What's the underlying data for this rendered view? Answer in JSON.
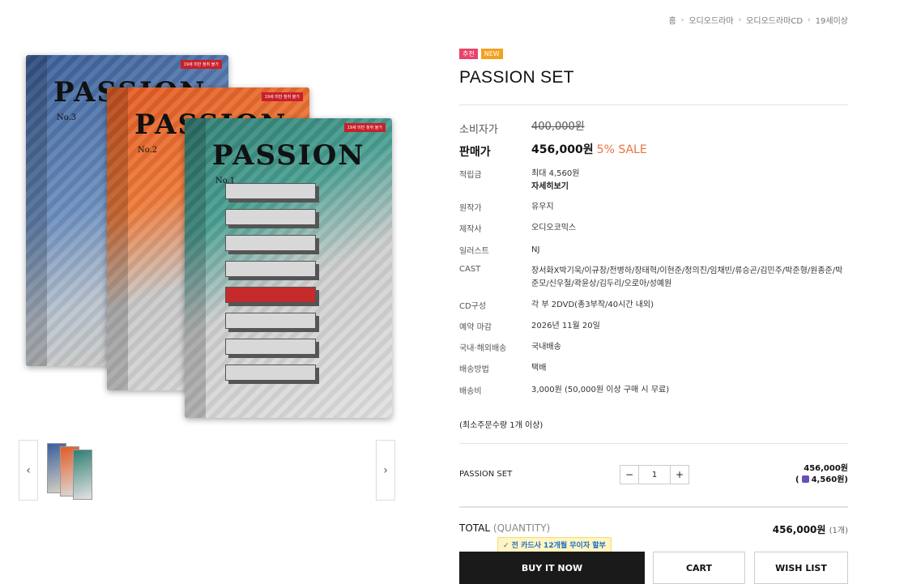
{
  "breadcrumb": [
    "홈",
    "오디오드라마",
    "오디오드라마CD",
    "19세이상"
  ],
  "badges": {
    "recommend": "추천",
    "new": "NEW"
  },
  "product": {
    "title": "PASSION SET"
  },
  "cover": {
    "title": "PASSION",
    "vols": [
      "No.3",
      "No.2",
      "No.1"
    ],
    "rating": "19세 미만 청취 불가"
  },
  "price": {
    "consumer_label": "소비자가",
    "consumer_value": "400,000원",
    "sale_label": "판매가",
    "sale_value": "456,000원",
    "sale_rate": "5% SALE"
  },
  "details": [
    {
      "label": "적립금",
      "value": "최대 4,560원",
      "link": "자세히보기"
    },
    {
      "label": "원작가",
      "value": "유우지"
    },
    {
      "label": "제작사",
      "value": "오디오코믹스"
    },
    {
      "label": "일러스트",
      "value": "NJ"
    },
    {
      "label": "CAST",
      "value": "장서화X박기욱/이규창/전병하/장태혁/이현준/정의진/임채빈/류승곤/김민주/박준형/원종준/박준모/신우철/곽윤상/김두리/오로아/성예원"
    },
    {
      "label": "CD구성",
      "value": "각 부 2DVD(총3부작/40시간 내외)"
    },
    {
      "label": "예약 마감",
      "value": "2026년 11월 20일"
    },
    {
      "label": "국내·해외배송",
      "value": "국내배송"
    },
    {
      "label": "배송방법",
      "value": "택배"
    },
    {
      "label": "배송비",
      "value": "3,000원 (50,000원 이상 구매 시 무료)"
    }
  ],
  "min_order": "(최소주문수량 1개 이상)",
  "option": {
    "name": "PASSION SET",
    "minus": "−",
    "plus": "+",
    "quantity": "1",
    "price": "456,000원",
    "mileage": "4,560원"
  },
  "total": {
    "label": "TOTAL",
    "quantity_label": "(QUANTITY)",
    "amount": "456,000원",
    "count": "(1개)"
  },
  "card_banner": "✓ 전 카드사 12개월 무이자 할부",
  "buttons": {
    "buy": "BUY IT NOW",
    "cart": "CART",
    "wishlist": "WISH LIST"
  },
  "nav": {
    "prev": "‹",
    "next": "›"
  }
}
